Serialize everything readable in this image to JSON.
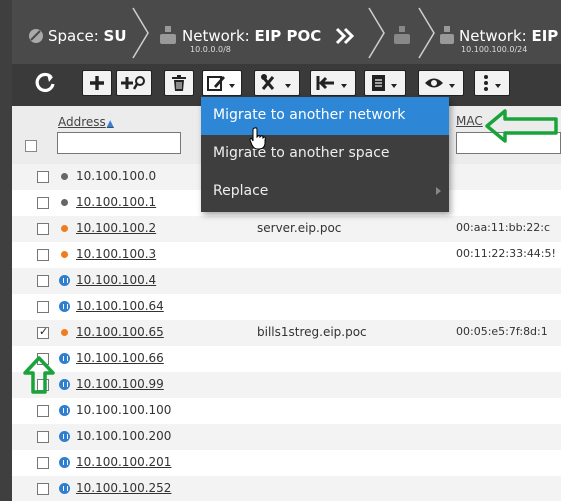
{
  "breadcrumb": {
    "space": {
      "label": "Space:",
      "value": "SU"
    },
    "network1": {
      "label": "Network:",
      "value": "EIP POC",
      "sub": "10.0.0.0/8"
    },
    "network2": {
      "label": "Network:",
      "value": "EIP",
      "sub": "10.100.100.0/24"
    }
  },
  "columns": {
    "address": "Address",
    "mac": "MAC"
  },
  "menu": {
    "items": [
      {
        "label": "Migrate to another network"
      },
      {
        "label": "Migrate to another space"
      },
      {
        "label": "Replace"
      }
    ]
  },
  "rows": [
    {
      "address": "10.100.100.0",
      "status": "gray",
      "name": "",
      "mac": "",
      "checked": false,
      "link": false
    },
    {
      "address": "10.100.100.1",
      "status": "gray",
      "name": "",
      "mac": "",
      "checked": false,
      "link": true
    },
    {
      "address": "10.100.100.2",
      "status": "orange",
      "name": "server.eip.poc",
      "mac": "00:aa:11:bb:22:c",
      "checked": false,
      "link": true
    },
    {
      "address": "10.100.100.3",
      "status": "orange",
      "name": "",
      "mac": "00:11:22:33:44:5!",
      "checked": false,
      "link": true
    },
    {
      "address": "10.100.100.4",
      "status": "blue",
      "name": "",
      "mac": "",
      "checked": false,
      "link": true
    },
    {
      "address": "10.100.100.64",
      "status": "blue",
      "name": "",
      "mac": "",
      "checked": false,
      "link": true
    },
    {
      "address": "10.100.100.65",
      "status": "orange",
      "name": "bills1streg.eip.poc",
      "mac": "00:05:e5:7f:8d:1",
      "checked": true,
      "link": true
    },
    {
      "address": "10.100.100.66",
      "status": "blue",
      "name": "",
      "mac": "",
      "checked": false,
      "link": true
    },
    {
      "address": "10.100.100.99",
      "status": "blue",
      "name": "",
      "mac": "",
      "checked": false,
      "link": true
    },
    {
      "address": "10.100.100.100",
      "status": "blue",
      "name": "",
      "mac": "",
      "checked": false,
      "link": false
    },
    {
      "address": "10.100.100.200",
      "status": "blue",
      "name": "",
      "mac": "",
      "checked": false,
      "link": false
    },
    {
      "address": "10.100.100.201",
      "status": "blue",
      "name": "",
      "mac": "",
      "checked": false,
      "link": true
    },
    {
      "address": "10.100.100.252",
      "status": "blue",
      "name": "",
      "mac": "",
      "checked": false,
      "link": true
    }
  ],
  "colors": {
    "highlight": "#2d87d6",
    "status_orange": "#f07c1e",
    "status_blue": "#2f7fd0",
    "arrow_green": "#1aa33a"
  }
}
